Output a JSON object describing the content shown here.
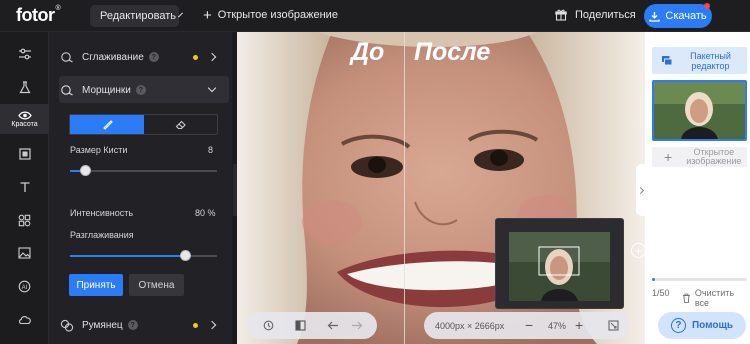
{
  "header": {
    "logo": "fotor",
    "logo_mark": "®",
    "edit_label": "Редактировать",
    "open_label": "Открытое изображение",
    "share_label": "Поделиться",
    "download_label": "Скачать"
  },
  "sidebar_icons": [
    "adjust-icon",
    "flask-icon",
    "eye-beauty-icon",
    "frame-icon",
    "text-icon",
    "elements-icon",
    "photo-icon",
    "ai-icon",
    "cloud-icon"
  ],
  "sidebar_active_label": "Красота",
  "panel": {
    "smoothing_label": "Сглаживание",
    "wrinkles_label": "Морщинки",
    "brush_size_label": "Размер Кисти",
    "brush_size_value": "8",
    "brush_size_level": 0.1,
    "intensity_label": "Интенсивность",
    "intensity_value": "80 %",
    "smoothing_sub_label": "Разглаживания",
    "smoothing_level": 0.78,
    "apply_label": "Принять",
    "cancel_label": "Отмена",
    "blush_label": "Румянец"
  },
  "canvas": {
    "before_label": "До",
    "after_label": "После",
    "dimensions": "4000px × 2666px",
    "zoom": "47%"
  },
  "right_panel": {
    "batch_label_1": "Пакетный",
    "batch_label_2": "редактор",
    "open_label_1": "Открытое",
    "open_label_2": "изображение",
    "count": "1/50",
    "clear_label": "Очистить все",
    "help_label": "Помощь"
  },
  "colors": {
    "accent": "#2b7cf6",
    "indicator": "#f5c518"
  }
}
